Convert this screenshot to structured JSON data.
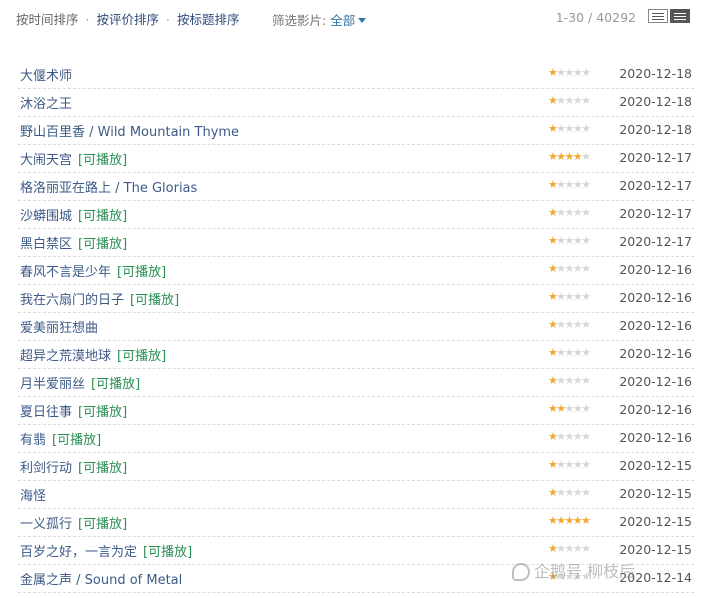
{
  "sort_bar": {
    "sort_by_time": "按时间排序",
    "sep1": "·",
    "sort_by_rating": "按评价排序",
    "sep2": "·",
    "sort_by_title": "按标题排序"
  },
  "filter": {
    "label": "筛选影片:",
    "value": "全部"
  },
  "pagination": {
    "range": "1-30 / 40292"
  },
  "playable_tag": "[可播放]",
  "colors": {
    "star_on": "#f2a92f",
    "star_off": "#d7d7d7",
    "link": "#3d5a87",
    "playable": "#2a8f53"
  },
  "movies": [
    {
      "title": "大偃术师",
      "rating": 1,
      "date": "2020-12-18",
      "playable": false
    },
    {
      "title": "沐浴之王",
      "rating": 1,
      "date": "2020-12-18",
      "playable": false
    },
    {
      "title": "野山百里香 / Wild Mountain Thyme",
      "rating": 1,
      "date": "2020-12-18",
      "playable": false
    },
    {
      "title": "大闹天宫",
      "rating": 4,
      "date": "2020-12-17",
      "playable": true
    },
    {
      "title": "格洛丽亚在路上 / The Glorias",
      "rating": 1,
      "date": "2020-12-17",
      "playable": false
    },
    {
      "title": "沙蟒围城",
      "rating": 1,
      "date": "2020-12-17",
      "playable": true
    },
    {
      "title": "黑白禁区",
      "rating": 1,
      "date": "2020-12-17",
      "playable": true
    },
    {
      "title": "春风不言是少年",
      "rating": 1,
      "date": "2020-12-16",
      "playable": true
    },
    {
      "title": "我在六扇门的日子",
      "rating": 1,
      "date": "2020-12-16",
      "playable": true
    },
    {
      "title": "爱美丽狂想曲",
      "rating": 1,
      "date": "2020-12-16",
      "playable": false
    },
    {
      "title": "超异之荒漠地球",
      "rating": 1,
      "date": "2020-12-16",
      "playable": true
    },
    {
      "title": "月半爱丽丝",
      "rating": 1,
      "date": "2020-12-16",
      "playable": true
    },
    {
      "title": "夏日往事",
      "rating": 2,
      "date": "2020-12-16",
      "playable": true
    },
    {
      "title": "有翡",
      "rating": 1,
      "date": "2020-12-16",
      "playable": true
    },
    {
      "title": "利剑行动",
      "rating": 1,
      "date": "2020-12-15",
      "playable": true
    },
    {
      "title": "海怪",
      "rating": 1,
      "date": "2020-12-15",
      "playable": false
    },
    {
      "title": "一义孤行",
      "rating": 5,
      "date": "2020-12-15",
      "playable": true
    },
    {
      "title": "百岁之好，一言为定",
      "rating": 1,
      "date": "2020-12-15",
      "playable": true
    },
    {
      "title": "金属之声 / Sound of Metal",
      "rating": 1,
      "date": "2020-12-14",
      "playable": false
    }
  ],
  "watermark": {
    "text": "企鹅号 柳枝后"
  }
}
